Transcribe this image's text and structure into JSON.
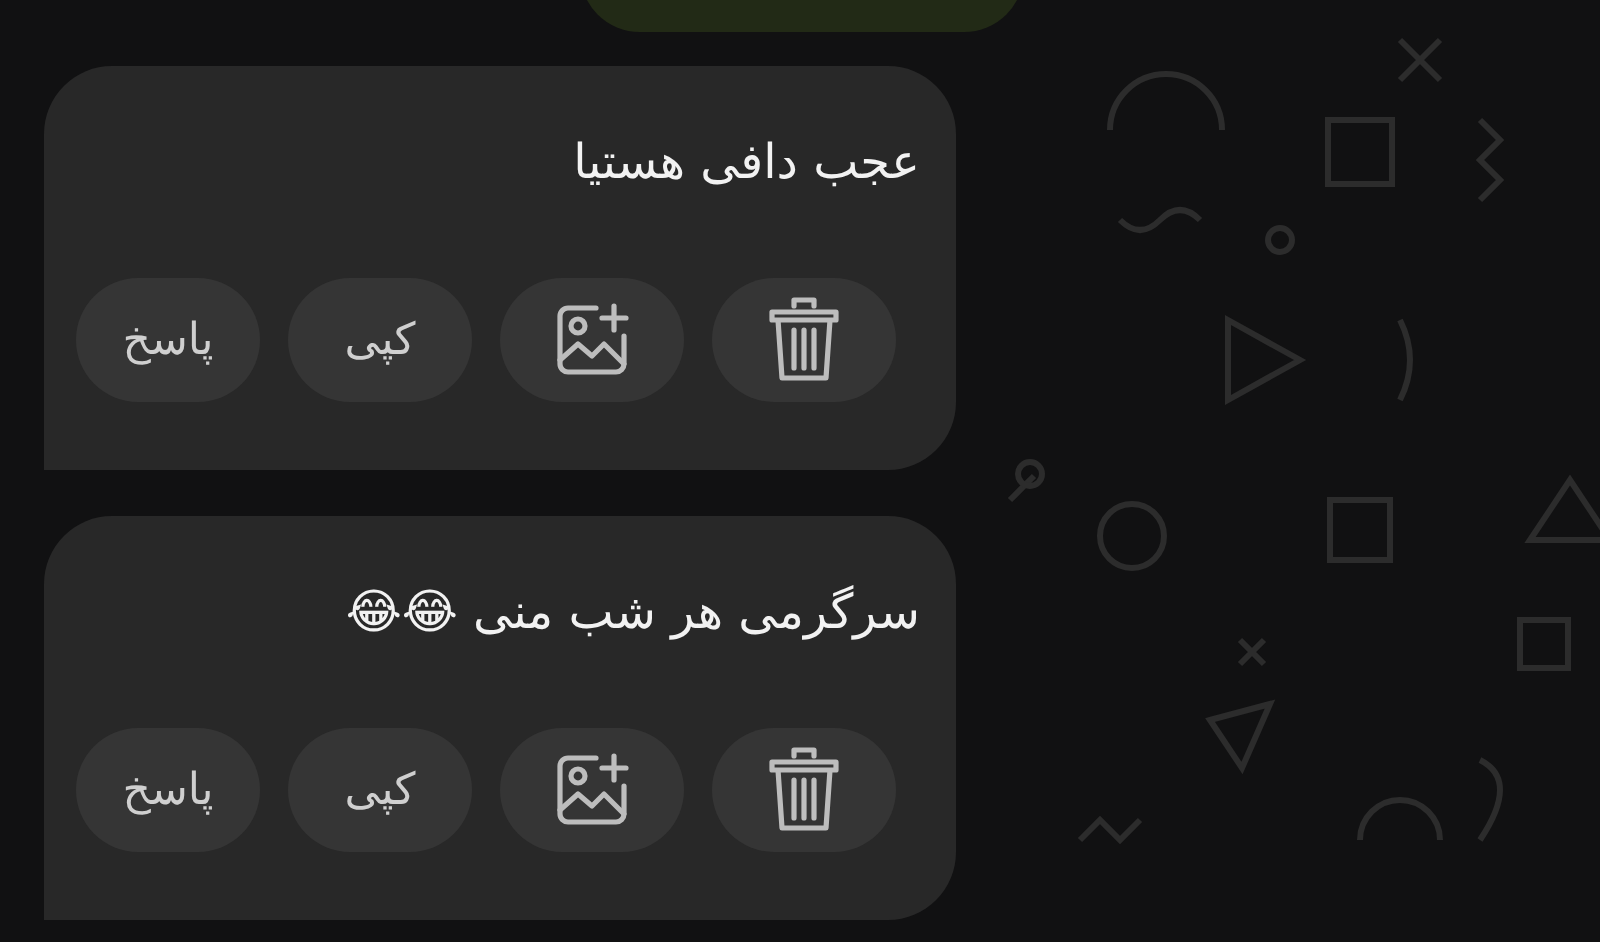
{
  "top_bubble": {
    "kind": "outgoing"
  },
  "messages": [
    {
      "text": "عجب دافی هستیا",
      "actions": [
        {
          "kind": "delete"
        },
        {
          "kind": "add-image"
        },
        {
          "kind": "copy",
          "label": "کپی"
        },
        {
          "kind": "reply",
          "label": "پاسخ"
        }
      ]
    },
    {
      "text": "سرگرمی هر شب منی 😂😂",
      "actions": [
        {
          "kind": "delete"
        },
        {
          "kind": "add-image"
        },
        {
          "kind": "copy",
          "label": "کپی"
        },
        {
          "kind": "reply",
          "label": "پاسخ"
        }
      ]
    }
  ]
}
